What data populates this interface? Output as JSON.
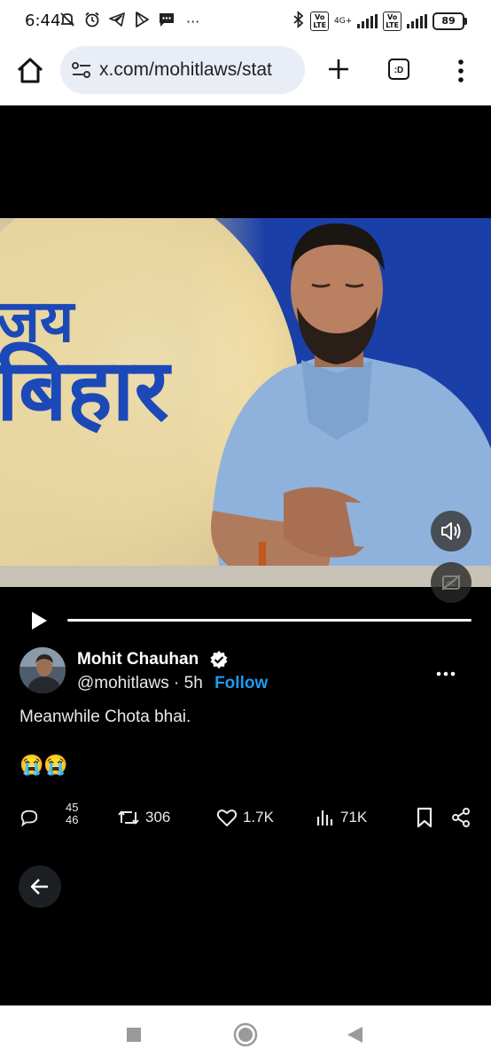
{
  "status": {
    "time": "6:44",
    "network": "4G+",
    "volte1": "Vo\nLTE",
    "volte2": "Vo\nLTE",
    "battery": "89",
    "more": "···"
  },
  "browser": {
    "url": "x.com/mohitlaws/stat",
    "tabs_label": ":D"
  },
  "video": {
    "overlay_line1": "जय",
    "overlay_line2": "बिहार"
  },
  "tweet": {
    "author_name": "Mohit Chauhan",
    "handle": "@mohitlaws",
    "separator": " · ",
    "time": "5h",
    "follow_label": "Follow",
    "text": "Meanwhile Chota bhai.",
    "emoji": "😭😭",
    "reply_count_top": "45",
    "reply_count_bottom": "46",
    "retweets": "306",
    "likes": "1.7K",
    "views": "71K"
  },
  "colors": {
    "accent": "#1d9bf0",
    "background": "#000000",
    "text": "#e7e9ea"
  }
}
